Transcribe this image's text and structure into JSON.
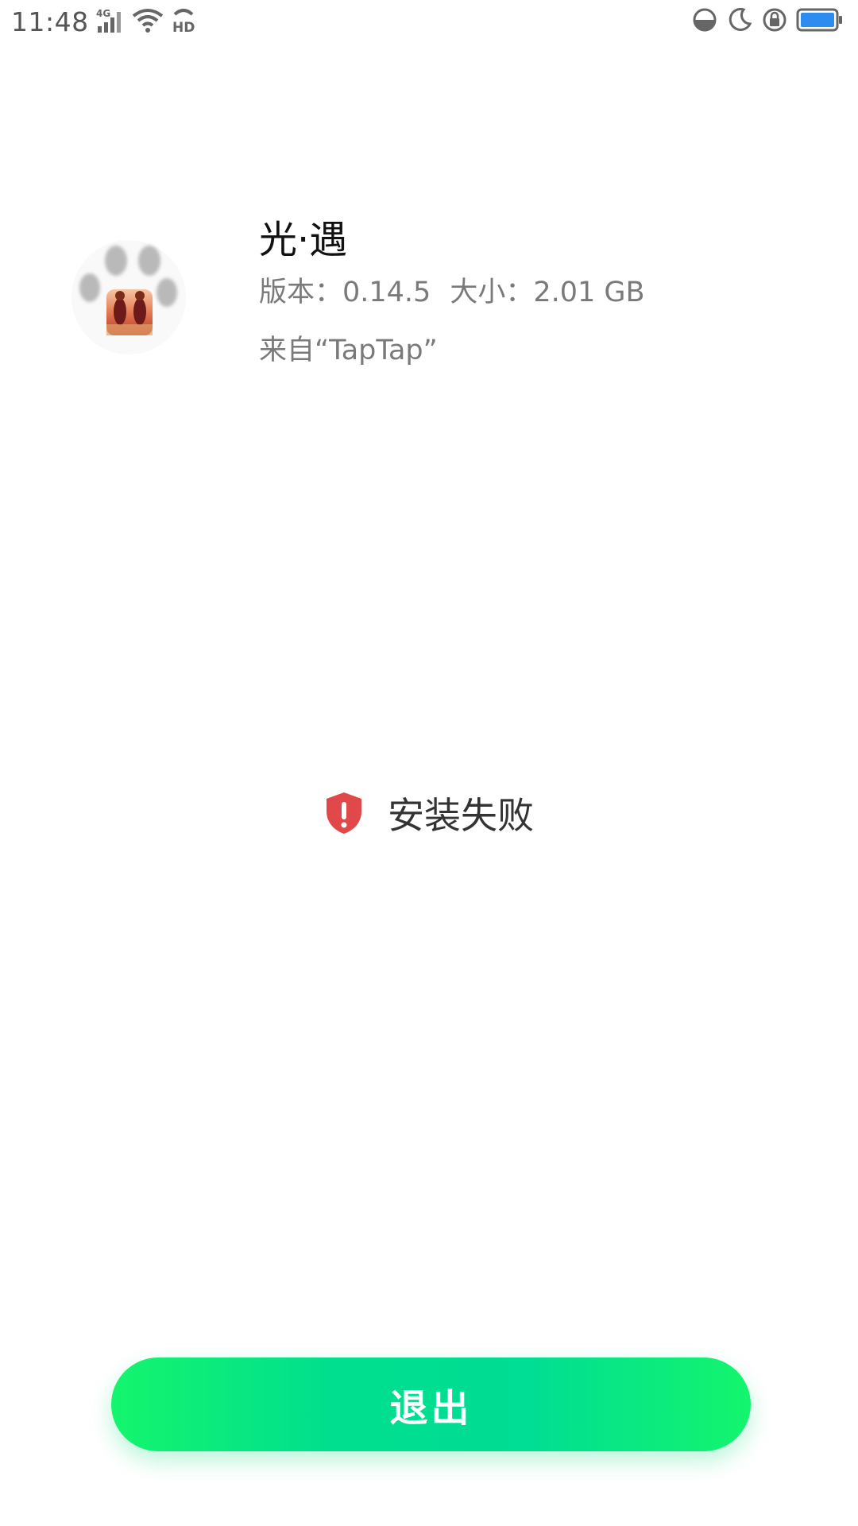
{
  "status_bar": {
    "time": "11:48",
    "network": "4G",
    "hd_label": "HD",
    "icons": [
      "signal-4g-icon",
      "wifi-icon",
      "hd-voice-icon",
      "data-saver-icon",
      "moon-icon",
      "rotation-lock-icon",
      "battery-icon"
    ],
    "battery_color": "#2c8cf0"
  },
  "app": {
    "name": "光·遇",
    "version_label": "版本：0.14.5",
    "size_label": "大小：2.01 GB",
    "source_label": "来自“TapTap”",
    "icon": "paw-app-icon"
  },
  "result": {
    "icon": "shield-error-icon",
    "text": "安装失败",
    "icon_color": "#e0484a"
  },
  "exit_button": {
    "label": "退出",
    "color": "#00dd8f"
  }
}
